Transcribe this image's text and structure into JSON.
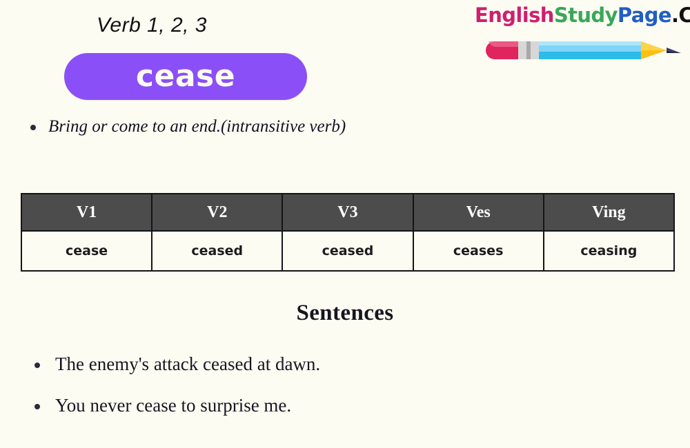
{
  "header": {
    "verb_title": "Verb 1, 2, 3",
    "word": "cease",
    "word_pill_color": "#8b4ff7",
    "word_text_color": "#fdfcf3"
  },
  "logo": {
    "segments": [
      {
        "text": "English",
        "color": "#cf1f6e"
      },
      {
        "text": "Study",
        "color": "#3aa757"
      },
      {
        "text": "Page",
        "color": "#1f5fc4"
      },
      {
        "text": ".Com",
        "color": "#111111"
      }
    ],
    "pencil": {
      "eraser_color": "#e0245e",
      "ferrule_color": "#c9c9c9",
      "body_color": "#7fd4f7",
      "body_shadow_color": "#2bbde8",
      "tip_color": "#fbc112",
      "point_color": "#232448"
    }
  },
  "definition": {
    "items": [
      "Bring or come to an end.(intransitive verb)"
    ]
  },
  "table": {
    "headers": [
      "V1",
      "V2",
      "V3",
      "Ves",
      "Ving"
    ],
    "rows": [
      [
        "cease",
        "ceased",
        "ceased",
        "ceases",
        "ceasing"
      ]
    ],
    "header_bg": "#4c4c4c",
    "header_color": "#ffffff",
    "cell_bg": "#fdfcf3",
    "border_color": "#141414"
  },
  "sentences": {
    "heading": "Sentences",
    "items": [
      "The enemy's attack ceased at dawn.",
      "You never cease to surprise me."
    ]
  },
  "page": {
    "background_color": "#fdfcf3"
  }
}
